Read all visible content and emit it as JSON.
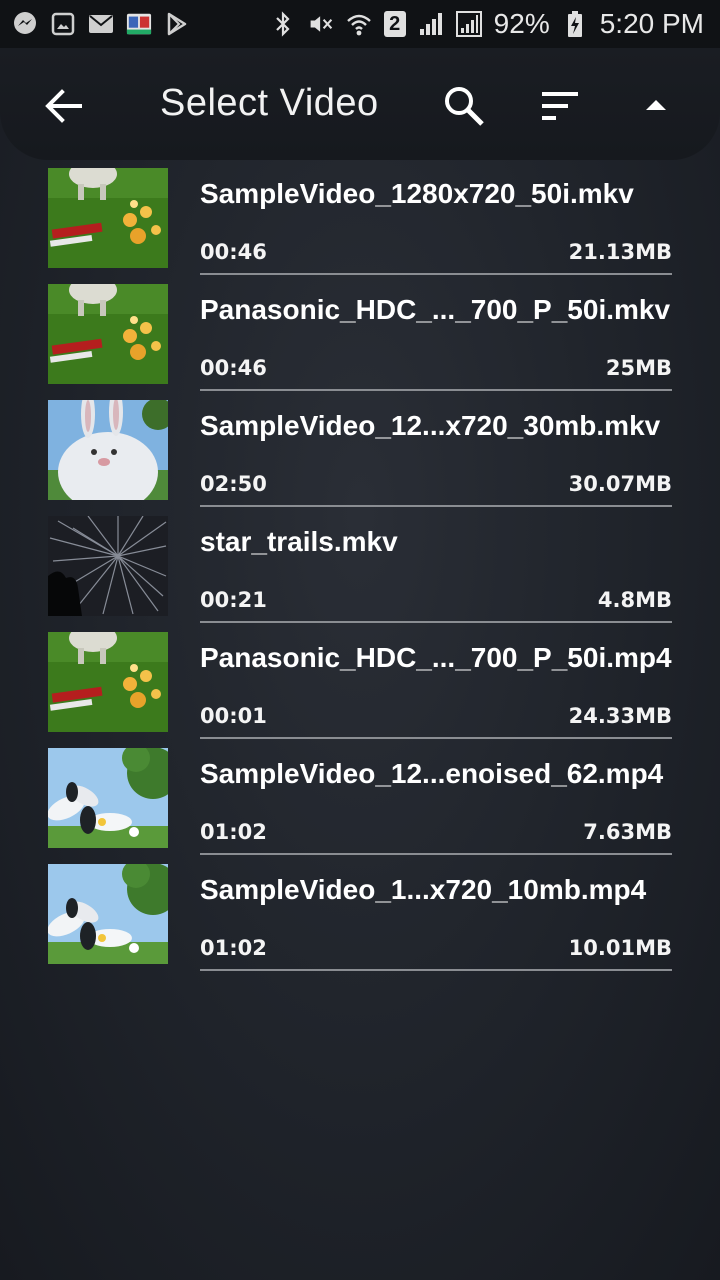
{
  "status_bar": {
    "battery": "92%",
    "time": "5:20 PM",
    "sim": "2",
    "icons_left": [
      "messenger-icon",
      "gallery-icon",
      "email-icon",
      "calendar-app-icon",
      "play-store-icon"
    ],
    "icons_right": [
      "bluetooth-icon",
      "mute-icon",
      "wifi-icon",
      "sim-icon",
      "signal-icon",
      "signal-icon",
      "battery-charging-icon"
    ]
  },
  "header": {
    "title": "Select Video",
    "back_icon": "back-arrow-icon",
    "search_icon": "search-icon",
    "sort_icon": "sort-icon",
    "collapse_icon": "collapse-icon"
  },
  "videos": [
    {
      "name": "SampleVideo_1280x720_50i.mkv",
      "duration": "00:46",
      "size": "21.13MB",
      "thumb": "sheep-flowers"
    },
    {
      "name": "Panasonic_HDC_..._700_P_50i.mkv",
      "duration": "00:46",
      "size": "25MB",
      "thumb": "sheep-flowers"
    },
    {
      "name": "SampleVideo_12...x720_30mb.mkv",
      "duration": "02:50",
      "size": "30.07MB",
      "thumb": "bunny"
    },
    {
      "name": "star_trails.mkv",
      "duration": "00:21",
      "size": "4.8MB",
      "thumb": "star-trails"
    },
    {
      "name": "Panasonic_HDC_..._700_P_50i.mp4",
      "duration": "00:01",
      "size": "24.33MB",
      "thumb": "sheep-flowers"
    },
    {
      "name": "SampleVideo_12...enoised_62.mp4",
      "duration": "01:02",
      "size": "7.63MB",
      "thumb": "white-flowers"
    },
    {
      "name": "SampleVideo_1...x720_10mb.mp4",
      "duration": "01:02",
      "size": "10.01MB",
      "thumb": "white-flowers"
    }
  ]
}
